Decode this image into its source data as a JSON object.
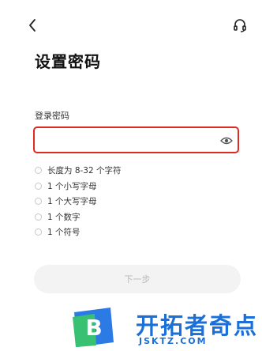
{
  "header": {
    "back_icon": "chevron-left-icon",
    "support_icon": "headset-icon"
  },
  "title": "设置密码",
  "password_field": {
    "label": "登录密码",
    "value": "",
    "placeholder": "",
    "toggle_icon": "eye-icon",
    "border_color": "#e02a1f"
  },
  "rules": [
    {
      "text": "长度为 8-32 个字符"
    },
    {
      "text": "1 个小写字母"
    },
    {
      "text": "1 个大写字母"
    },
    {
      "text": "1 个数字"
    },
    {
      "text": "1 个符号"
    }
  ],
  "next_button": {
    "label": "下一步",
    "enabled": false
  },
  "watermark": {
    "logo_letter": "B",
    "name": "开拓者奇点",
    "url": "JSKTZ.COM",
    "brand_color": "#1a6fd8"
  }
}
